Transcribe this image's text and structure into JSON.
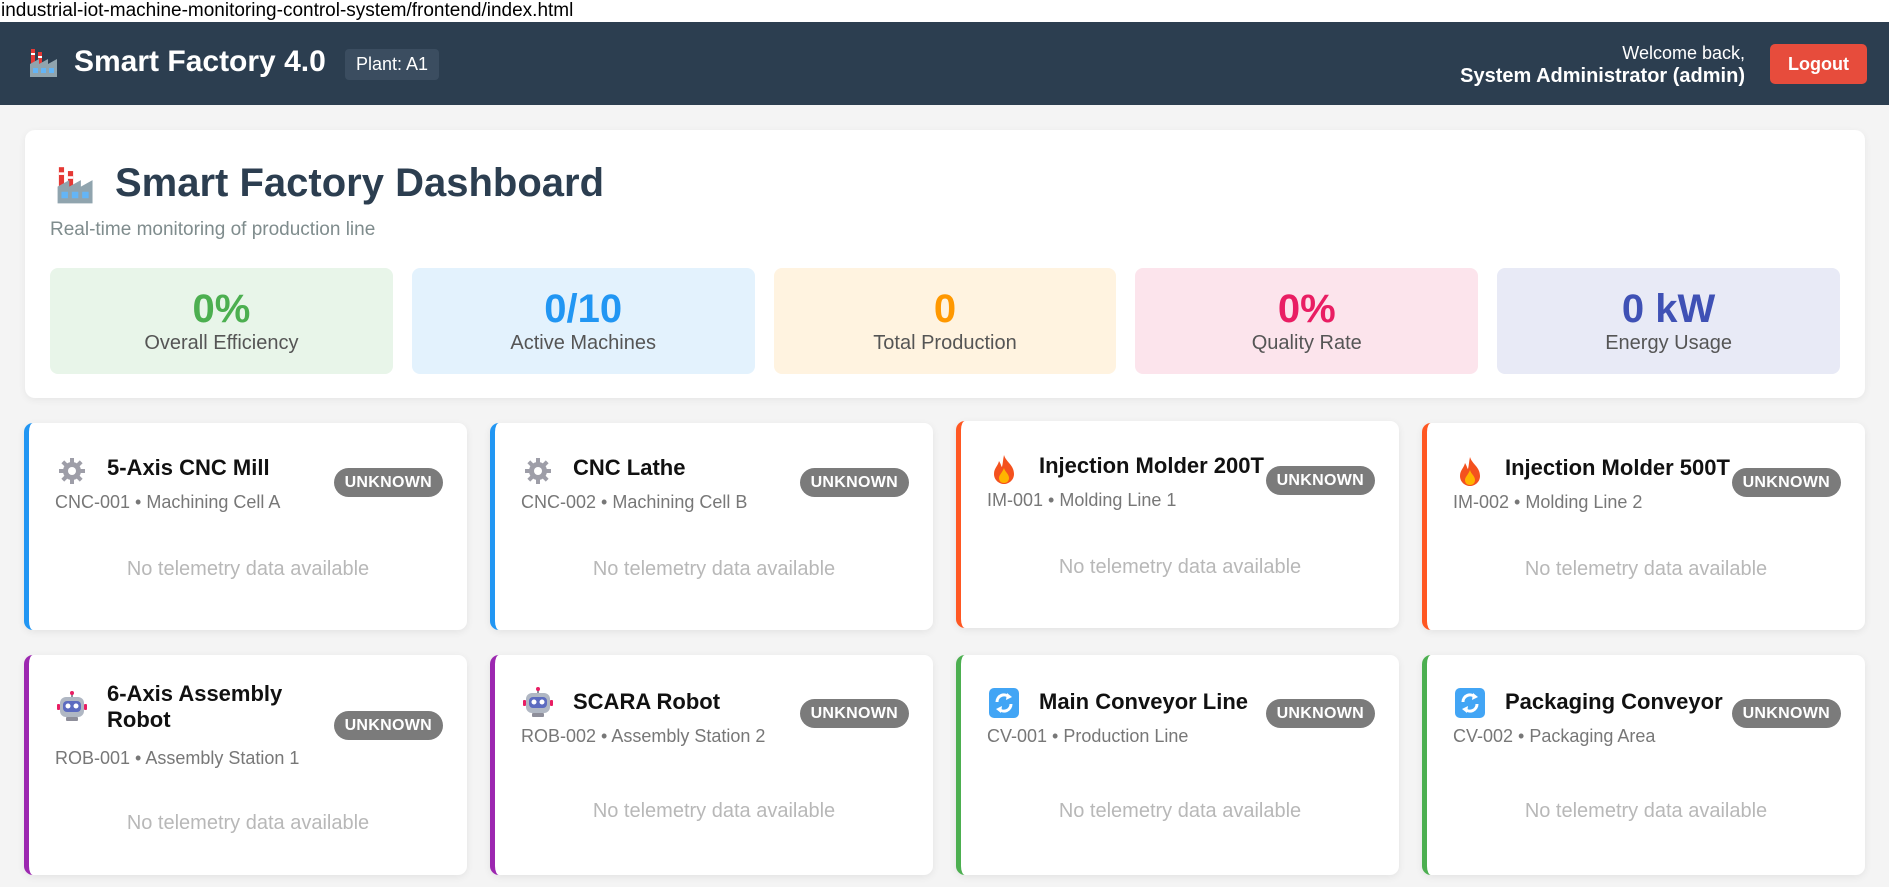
{
  "browser": {
    "url": "industrial-iot-machine-monitoring-control-system/frontend/index.html"
  },
  "header": {
    "app_title": "Smart Factory 4.0",
    "plant_badge": "Plant: A1",
    "welcome_line": "Welcome back,",
    "user_line": "System Administrator (admin)",
    "logout_label": "Logout",
    "logo_icon": "factory-icon"
  },
  "dashboard": {
    "title": "Smart Factory Dashboard",
    "subtitle": "Real-time monitoring of production line",
    "stats": [
      {
        "value": "0%",
        "label": "Overall Efficiency",
        "color": "#4caf50",
        "bg": "#e8f5e9"
      },
      {
        "value": "0/10",
        "label": "Active Machines",
        "color": "#2196f3",
        "bg": "#e3f2fd"
      },
      {
        "value": "0",
        "label": "Total Production",
        "color": "#ff9800",
        "bg": "#fff3e0"
      },
      {
        "value": "0%",
        "label": "Quality Rate",
        "color": "#e91e63",
        "bg": "#fce4ec"
      },
      {
        "value": "0 kW",
        "label": "Energy Usage",
        "color": "#3f51b5",
        "bg": "#e8eaf6"
      }
    ]
  },
  "machines": [
    {
      "name": "5-Axis CNC Mill",
      "meta": "CNC-001 • Machining Cell A",
      "status": "UNKNOWN",
      "empty": "No telemetry data available",
      "icon": "gear-icon",
      "accent": "#2196f3"
    },
    {
      "name": "CNC Lathe",
      "meta": "CNC-002 • Machining Cell B",
      "status": "UNKNOWN",
      "empty": "No telemetry data available",
      "icon": "gear-icon",
      "accent": "#2196f3"
    },
    {
      "name": "Injection Molder 200T",
      "meta": "IM-001 • Molding Line 1",
      "status": "UNKNOWN",
      "empty": "No telemetry data available",
      "icon": "fire-icon",
      "accent": "#ff5722"
    },
    {
      "name": "Injection Molder 500T",
      "meta": "IM-002 • Molding Line 2",
      "status": "UNKNOWN",
      "empty": "No telemetry data available",
      "icon": "fire-icon",
      "accent": "#ff5722"
    },
    {
      "name": "6-Axis Assembly Robot",
      "meta": "ROB-001 • Assembly Station 1",
      "status": "UNKNOWN",
      "empty": "No telemetry data available",
      "icon": "robot-icon",
      "accent": "#9c27b0"
    },
    {
      "name": "SCARA Robot",
      "meta": "ROB-002 • Assembly Station 2",
      "status": "UNKNOWN",
      "empty": "No telemetry data available",
      "icon": "robot-icon",
      "accent": "#9c27b0"
    },
    {
      "name": "Main Conveyor Line",
      "meta": "CV-001 • Production Line",
      "status": "UNKNOWN",
      "empty": "No telemetry data available",
      "icon": "cycle-arrows-icon",
      "accent": "#4caf50"
    },
    {
      "name": "Packaging Conveyor",
      "meta": "CV-002 • Packaging Area",
      "status": "UNKNOWN",
      "empty": "No telemetry data available",
      "icon": "cycle-arrows-icon",
      "accent": "#4caf50"
    }
  ]
}
